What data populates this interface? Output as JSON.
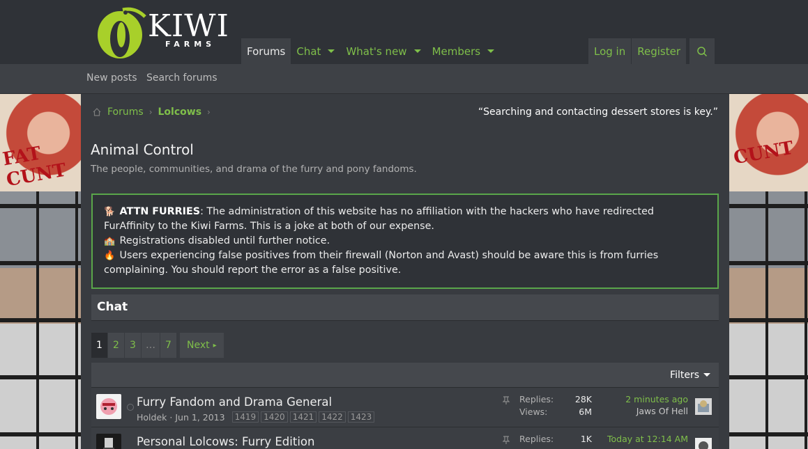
{
  "header": {
    "logo_word": "KIWI",
    "logo_sub": "FARMS",
    "nav": [
      {
        "label": "Forums",
        "active": true,
        "dropdown": false
      },
      {
        "label": "Chat",
        "active": false,
        "dropdown": true
      },
      {
        "label": "What's new",
        "active": false,
        "dropdown": true
      },
      {
        "label": "Members",
        "active": false,
        "dropdown": true
      }
    ],
    "login": "Log in",
    "register": "Register",
    "search_icon": "search-icon"
  },
  "subnav": {
    "new_posts": "New posts",
    "search_forums": "Search forums"
  },
  "breadcrumb": {
    "home_icon": "home-icon",
    "items": [
      "Forums",
      "Lolcows"
    ]
  },
  "quote": "“Searching and contacting dessert stores is key.”",
  "page": {
    "title": "Animal Control",
    "description": "The people, communities, and drama of the furry and pony fandoms."
  },
  "notice": {
    "line1_bold": "ATTN FURRIES",
    "line1_rest": ": The administration of this website has no affiliation with the hackers who have redirected FurAffinity to the Kiwi Farms. This is a joke at both of our expense.",
    "line2": "Registrations disabled until further notice.",
    "line3": "Users experiencing false positives from their firewall (Norton and Avast) should be aware this is from furries complaining. You should report the error as a false positive.",
    "icons": [
      "dog-icon",
      "school-icon",
      "fire-icon"
    ]
  },
  "section": {
    "title": "Chat"
  },
  "pager": {
    "pages": [
      "1",
      "2",
      "3",
      "…",
      "7"
    ],
    "current": "1",
    "next": "Next"
  },
  "filters": {
    "label": "Filters"
  },
  "threads": [
    {
      "title": "Furry Fandom and Drama General",
      "author": "Holdek",
      "date": "Jun 1, 2013",
      "pages": [
        "1419",
        "1420",
        "1421",
        "1422",
        "1423"
      ],
      "replies_label": "Replies:",
      "replies": "28K",
      "views_label": "Views:",
      "views": "6M",
      "last_time": "2 minutes ago",
      "last_user": "Jaws Of Hell"
    },
    {
      "title": "Personal Lolcows: Furry Edition",
      "replies_label": "Replies:",
      "replies": "1K",
      "last_time": "Today at 12:14 AM"
    }
  ],
  "colors": {
    "accent": "#7fbf4a",
    "header_bg": "#2f3237",
    "notice_border": "#5aa64a"
  }
}
